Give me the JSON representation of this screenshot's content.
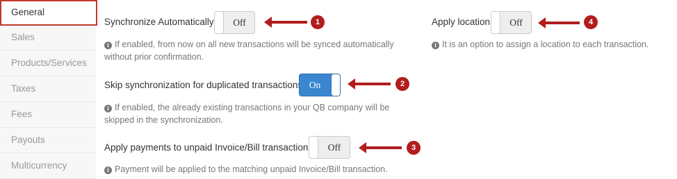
{
  "sidebar": {
    "items": [
      {
        "label": "General",
        "active": true
      },
      {
        "label": "Sales"
      },
      {
        "label": "Products/Services"
      },
      {
        "label": "Taxes"
      },
      {
        "label": "Fees"
      },
      {
        "label": "Payouts"
      },
      {
        "label": "Multicurrency"
      }
    ]
  },
  "settings": {
    "sync_auto": {
      "label": "Synchronize Automatically",
      "state": "Off",
      "help": "If enabled, from now on all new transactions will be synced automatically without prior confirmation."
    },
    "skip_duplicates": {
      "label": "Skip synchronization for duplicated transactions",
      "state": "On",
      "help": "If enabled, the already existing transactions in your QB company will be skipped in the synchronization."
    },
    "apply_payments": {
      "label": "Apply payments to unpaid Invoice/Bill transactions",
      "state": "Off",
      "help": "Payment will be applied to the matching unpaid Invoice/Bill transaction."
    },
    "apply_location": {
      "label": "Apply location",
      "state": "Off",
      "help": "It is an option to assign a location to each transaction."
    }
  },
  "info_icon_glyph": "i",
  "callouts": [
    "1",
    "2",
    "3",
    "4"
  ],
  "colors": {
    "active_border": "#c0392b",
    "toggle_on": "#3a87cf",
    "callout": "#b11d1d"
  }
}
